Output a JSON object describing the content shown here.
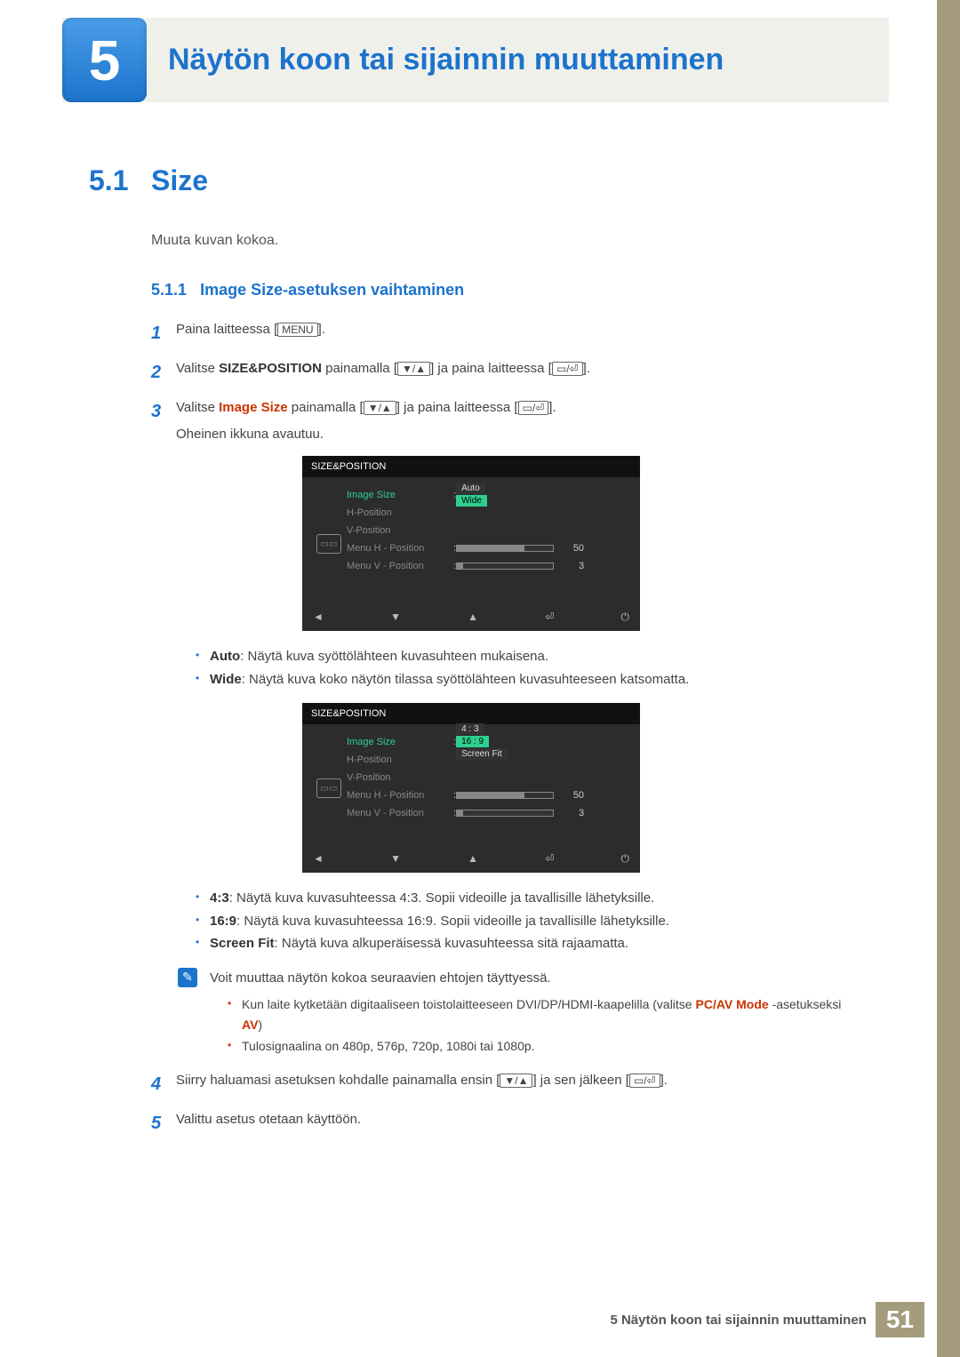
{
  "chapter": {
    "number": "5",
    "title": "Näytön koon tai sijainnin muuttaminen"
  },
  "section": {
    "number": "5.1",
    "title": "Size",
    "intro": "Muuta kuvan kokoa."
  },
  "subsection": {
    "number": "5.1.1",
    "title": "Image Size-asetuksen vaihtaminen"
  },
  "steps": {
    "s1": {
      "num": "1",
      "pre": "Paina laitteessa [",
      "btn": "MENU",
      "post": "]."
    },
    "s2": {
      "num": "2",
      "pre": "Valitse ",
      "strong": "SIZE&POSITION",
      "mid": " painamalla [",
      "arrows": "▼/▲",
      "mid2": "] ja paina laitteessa [",
      "enter": "▭/⏎",
      "post": "]."
    },
    "s3": {
      "num": "3",
      "pre": "Valitse ",
      "strong": "Image Size",
      "mid": " painamalla [",
      "arrows": "▼/▲",
      "mid2": "] ja paina laitteessa [",
      "enter": "▭/⏎",
      "post": "].",
      "tail": "Oheinen ikkuna avautuu."
    },
    "s4": {
      "num": "4",
      "pre": "Siirry haluamasi asetuksen kohdalle painamalla ensin [",
      "arrows": "▼/▲",
      "mid": "] ja sen jälkeen [",
      "enter": "▭/⏎",
      "post": "]."
    },
    "s5": {
      "num": "5",
      "text": "Valittu asetus otetaan käyttöön."
    }
  },
  "osd": {
    "title": "SIZE&POSITION",
    "rows": {
      "image_size": "Image Size",
      "h_position": "H-Position",
      "v_position": "V-Position",
      "menu_h": "Menu H - Position",
      "menu_v": "Menu V - Position"
    },
    "values": {
      "menu_h": "50",
      "menu_v": "3"
    },
    "footer": {
      "left": "◄",
      "down": "▼",
      "up": "▲",
      "enter": "⏎",
      "power": "⏻"
    }
  },
  "osd1_options": {
    "a": "Auto",
    "b": "Wide"
  },
  "osd2_options": {
    "a": "4 : 3",
    "b": "16 : 9",
    "c": "Screen Fit"
  },
  "bullets1": {
    "auto_label": "Auto",
    "auto_text": ": Näytä kuva syöttölähteen kuvasuhteen mukaisena.",
    "wide_label": "Wide",
    "wide_text": ": Näytä kuva koko näytön tilassa syöttölähteen kuvasuhteeseen katsomatta."
  },
  "bullets2": {
    "b43_label": "4:3",
    "b43_text": ": Näytä kuva kuvasuhteessa 4:3. Sopii videoille ja tavallisille lähetyksille.",
    "b169_label": "16:9",
    "b169_text": ": Näytä kuva kuvasuhteessa 16:9. Sopii videoille ja tavallisille lähetyksille.",
    "fit_label": "Screen Fit",
    "fit_text": ": Näytä kuva alkuperäisessä kuvasuhteessa sitä rajaamatta."
  },
  "note": {
    "lead": "Voit muuttaa näytön kokoa seuraavien ehtojen täyttyessä.",
    "n1_pre": "Kun laite kytketään digitaaliseen toistolaitteeseen DVI/DP/HDMI-kaapelilla (valitse ",
    "n1_s1": "PC/AV Mode",
    "n1_mid": " -asetukseksi ",
    "n1_s2": "AV",
    "n1_post": ")",
    "n2": "Tulosignaalina on 480p, 576p, 720p, 1080i tai 1080p."
  },
  "footer": {
    "text": "5 Näytön koon tai sijainnin muuttaminen",
    "page": "51"
  },
  "chart_data": null
}
